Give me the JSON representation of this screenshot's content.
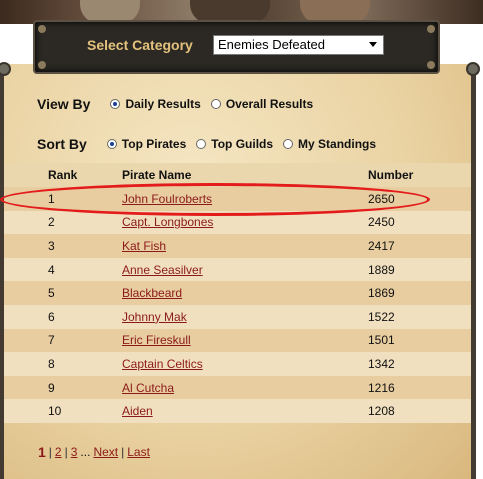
{
  "category": {
    "label": "Select Category",
    "selected": "Enemies Defeated"
  },
  "view_by": {
    "label": "View By",
    "options": [
      {
        "label": "Daily Results",
        "checked": true
      },
      {
        "label": "Overall Results",
        "checked": false
      }
    ]
  },
  "sort_by": {
    "label": "Sort By",
    "options": [
      {
        "label": "Top Pirates",
        "checked": true
      },
      {
        "label": "Top Guilds",
        "checked": false
      },
      {
        "label": "My Standings",
        "checked": false
      }
    ]
  },
  "table": {
    "headers": {
      "rank": "Rank",
      "name": "Pirate Name",
      "number": "Number"
    },
    "rows": [
      {
        "rank": "1",
        "name": "John Foulroberts",
        "number": "2650"
      },
      {
        "rank": "2",
        "name": "Capt. Longbones",
        "number": "2450"
      },
      {
        "rank": "3",
        "name": "Kat Fish",
        "number": "2417"
      },
      {
        "rank": "4",
        "name": "Anne Seasilver",
        "number": "1889"
      },
      {
        "rank": "5",
        "name": "Blackbeard",
        "number": "1869"
      },
      {
        "rank": "6",
        "name": "Johnny Mak",
        "number": "1522"
      },
      {
        "rank": "7",
        "name": "Eric Fireskull",
        "number": "1501"
      },
      {
        "rank": "8",
        "name": "Captain Celtics",
        "number": "1342"
      },
      {
        "rank": "9",
        "name": "Al Cutcha",
        "number": "1216"
      },
      {
        "rank": "10",
        "name": "Aiden",
        "number": "1208"
      }
    ]
  },
  "pager": {
    "current": "1",
    "pages": [
      "2",
      "3"
    ],
    "ellipsis": "...",
    "next": "Next",
    "last": "Last"
  },
  "colors": {
    "link": "#8b1a1a",
    "highlight": "#e31b1b",
    "category_label": "#e3c27c"
  }
}
